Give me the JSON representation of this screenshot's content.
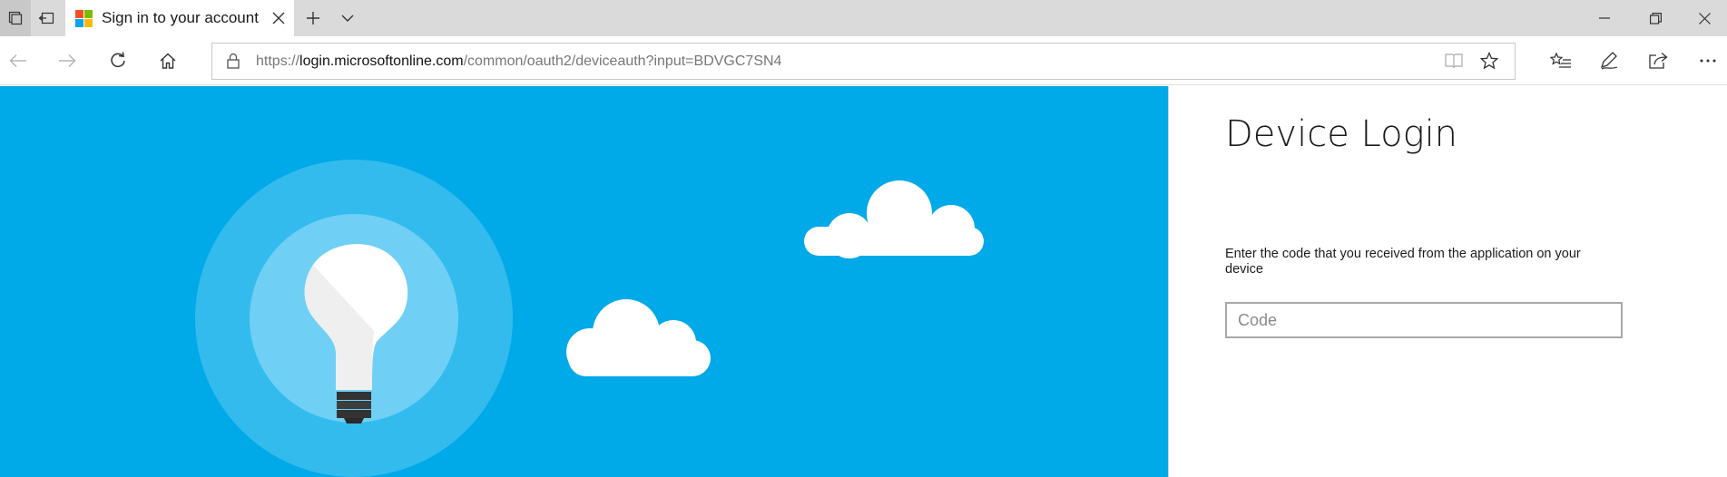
{
  "browser": {
    "tab": {
      "title": "Sign in to your account"
    },
    "address": {
      "scheme": "https://",
      "host": "login.microsoftonline.com",
      "path": "/common/oauth2/deviceauth?input=BDVGC7SN4"
    },
    "icons": {
      "tab_actions": [
        "tabs-aside-icon",
        "tab-preview-icon"
      ],
      "new_tab": "plus-icon",
      "tab_list": "chevron-down-icon",
      "window": [
        "minimize-icon",
        "restore-icon",
        "close-icon"
      ],
      "nav": [
        "back-icon",
        "forward-icon",
        "refresh-icon",
        "home-icon"
      ],
      "address_bar": [
        "lock-icon",
        "reading-view-icon",
        "favorite-star-icon"
      ],
      "toolbar": [
        "favorites-hub-icon",
        "web-note-pen-icon",
        "share-icon",
        "more-icon"
      ]
    }
  },
  "page": {
    "title": "Device Login",
    "description": "Enter the code that you received from the application on your device",
    "code_input": {
      "placeholder": "Code",
      "value": ""
    }
  },
  "colors": {
    "hero_background": "#00a9e8",
    "titlebar": "#dadada",
    "ms_logo": [
      "#f25022",
      "#7fba00",
      "#00a4ef",
      "#ffb900"
    ]
  }
}
